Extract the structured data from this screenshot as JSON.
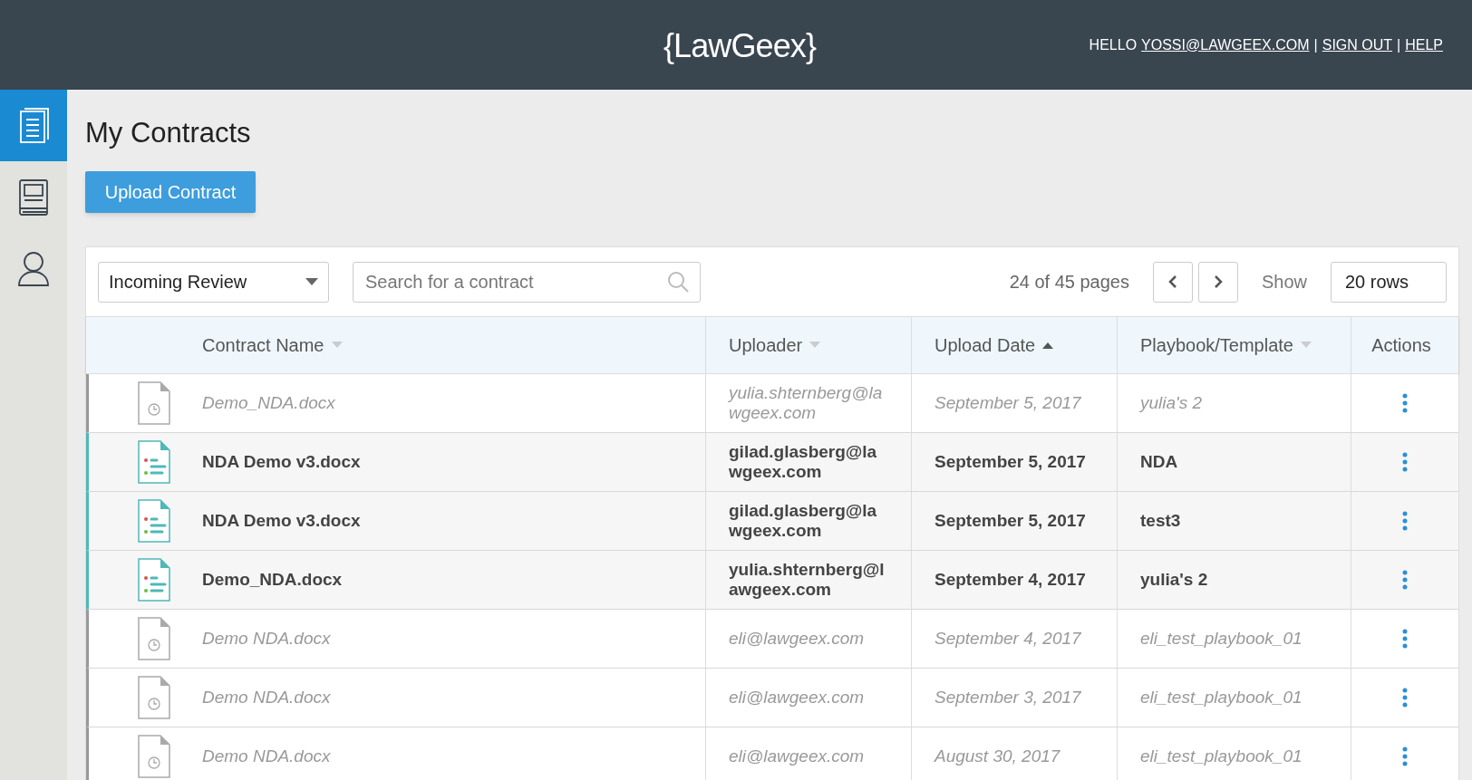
{
  "header": {
    "logo": "{LawGeex}",
    "greeting": "HELLO",
    "user_link": "YOSSI@LAWGEEX.COM",
    "separator_1": "|",
    "sign_out": "SIGN OUT",
    "separator_2": "|",
    "help": "HELP"
  },
  "sidebar": {
    "items": [
      {
        "kind": "documents",
        "selected": true
      },
      {
        "kind": "book",
        "selected": false
      },
      {
        "kind": "user",
        "selected": false
      }
    ]
  },
  "page_title": "My Contracts",
  "upload_button": "Upload Contract",
  "toolbar": {
    "filter": "Incoming Review",
    "search": {
      "placeholder": "Search for a contract"
    },
    "pages": "24 of 45 pages",
    "show_label": "Show",
    "rows_select": "20 rows"
  },
  "table": {
    "columns": [
      {
        "label": "Contract Name",
        "kind": "sortable"
      },
      {
        "label": "Uploader",
        "kind": "sortable"
      },
      {
        "label": "Upload Date",
        "kind": "ascending"
      },
      {
        "label": "Playbook/Template",
        "kind": "sortable"
      },
      {
        "label": "Actions",
        "kind": "plain"
      }
    ],
    "rows": [
      {
        "kind": "pending",
        "name": "Demo_NDA.docx",
        "uploader": "yulia.shternberg@lawgeex.com",
        "date": "September 5, 2017",
        "playbook": "yulia's 2"
      },
      {
        "kind": "reviewed",
        "name": "NDA Demo v3.docx",
        "uploader": "gilad.glasberg@lawgeex.com",
        "date": "September 5, 2017",
        "playbook": "NDA"
      },
      {
        "kind": "reviewed",
        "name": "NDA Demo v3.docx",
        "uploader": "gilad.glasberg@lawgeex.com",
        "date": "September 5, 2017",
        "playbook": "test3"
      },
      {
        "kind": "reviewed",
        "name": "Demo_NDA.docx",
        "uploader": "yulia.shternberg@lawgeex.com",
        "date": "September 4, 2017",
        "playbook": "yulia's 2"
      },
      {
        "kind": "pending",
        "name": "Demo NDA.docx",
        "uploader": "eli@lawgeex.com",
        "date": "September 4, 2017",
        "playbook": "eli_test_playbook_01"
      },
      {
        "kind": "pending",
        "name": "Demo NDA.docx",
        "uploader": "eli@lawgeex.com",
        "date": "September 3, 2017",
        "playbook": "eli_test_playbook_01"
      },
      {
        "kind": "pending",
        "name": "Demo NDA.docx",
        "uploader": "eli@lawgeex.com",
        "date": "August 30, 2017",
        "playbook": "eli_test_playbook_01"
      }
    ]
  }
}
